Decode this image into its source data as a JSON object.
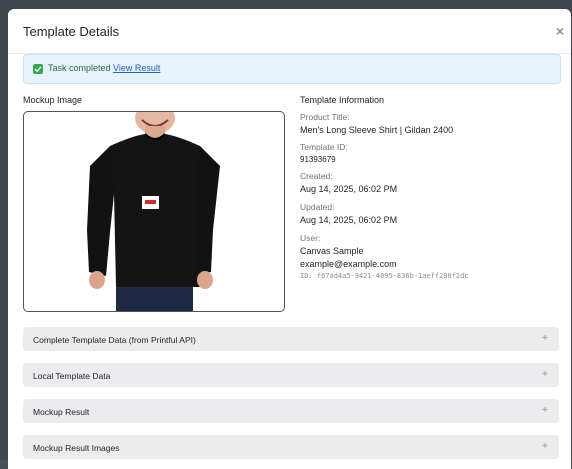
{
  "modal": {
    "title": "Template Details",
    "close_label": "×"
  },
  "alert": {
    "text": "Task completed",
    "link_label": "View Result",
    "icon": "check-square-icon",
    "color": "#3aa655"
  },
  "mockup": {
    "section_label": "Mockup Image",
    "image_alt": "Men's Long Sleeve Shirt mockup"
  },
  "info": {
    "section_label": "Template Information",
    "product_title_label": "Product Title:",
    "product_title": "Men's Long Sleeve Shirt | Gildan 2400",
    "template_id_label": "Template ID:",
    "template_id": "91393679",
    "created_label": "Created:",
    "created": "Aug 14, 2025, 06:02 PM",
    "updated_label": "Updated:",
    "updated": "Aug 14, 2025, 06:02 PM",
    "user_label": "User:",
    "user_name": "Canvas Sample",
    "user_email": "example@example.com",
    "user_id": "ID: f67ad4a5-9421-4095-836b-1aeff280f2dc"
  },
  "accordions": [
    {
      "label": "Complete Template Data (from Printful API)",
      "icon": "+"
    },
    {
      "label": "Local Template Data",
      "icon": "+"
    },
    {
      "label": "Mockup Result",
      "icon": "+"
    },
    {
      "label": "Mockup Result Images",
      "icon": "+"
    }
  ]
}
